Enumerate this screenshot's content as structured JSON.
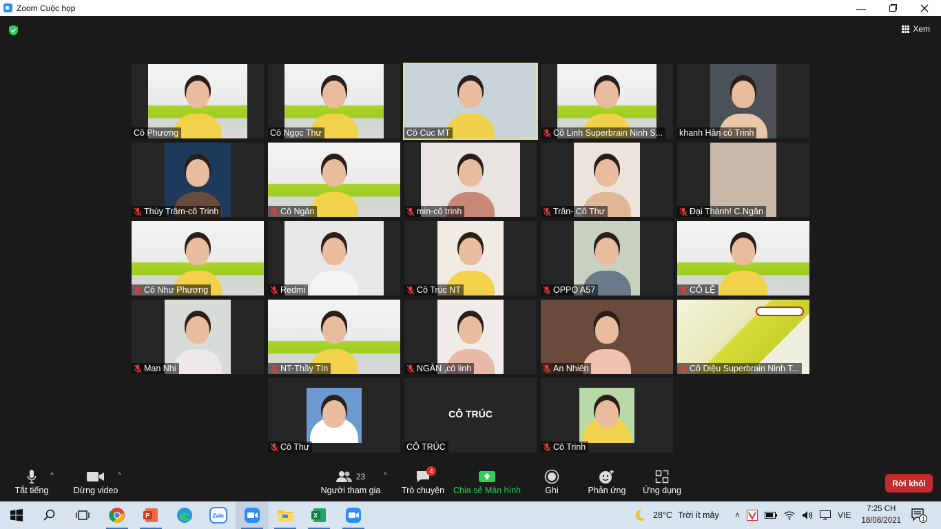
{
  "window": {
    "title": "Zoom Cuộc họp"
  },
  "top_bar": {
    "view_label": "Xem"
  },
  "participants": [
    {
      "name": "Cô Phương",
      "muted": false,
      "scene": "class",
      "bg": "#e6e0c8",
      "person": "#f2d24a"
    },
    {
      "name": "Cô Ngọc Thư",
      "muted": false,
      "scene": "class",
      "bg": "#e6e0c8",
      "person": "#f2d24a"
    },
    {
      "name": "Cô Cúc MT",
      "muted": false,
      "scene": "room",
      "bg": "#c8d4da",
      "person": "#f0d04a",
      "active": true
    },
    {
      "name": "Cô Linh Superbrain Ninh S...",
      "muted": true,
      "scene": "class",
      "bg": "#e6e0c8",
      "person": "#f2d24a"
    },
    {
      "name": "khanh Hân cô Trinh",
      "muted": false,
      "scene": "home",
      "bg": "#4a5258",
      "person": "#e8c8a8"
    },
    {
      "name": "Thùy Trâm-cô Trinh",
      "muted": true,
      "scene": "dark",
      "bg": "#1d3a5a",
      "person": "#6a4a3a"
    },
    {
      "name": "Cô Ngân",
      "muted": true,
      "scene": "class",
      "bg": "#e6e0c8",
      "person": "#f2d24a"
    },
    {
      "name": "min-cô trinh",
      "muted": true,
      "scene": "home",
      "bg": "#e8e4e0",
      "person": "#c88878"
    },
    {
      "name": "Trân- Cô Thư",
      "muted": true,
      "scene": "home",
      "bg": "#ece4dc",
      "person": "#e0b898"
    },
    {
      "name": "Đại Thành! C.Ngân",
      "muted": true,
      "scene": "blur",
      "bg": "#c8b8a8",
      "person": "#b09888"
    },
    {
      "name": "Cô Như Phương",
      "muted": true,
      "scene": "class",
      "bg": "#e6e0c8",
      "person": "#f2d24a"
    },
    {
      "name": "Redmi",
      "muted": true,
      "scene": "home",
      "bg": "#e8e8e8",
      "person": "#f4f4f4"
    },
    {
      "name": "Cô Trúc NT",
      "muted": true,
      "scene": "home",
      "bg": "#f0ece4",
      "person": "#f2d24a"
    },
    {
      "name": "OPPO A57",
      "muted": true,
      "scene": "home",
      "bg": "#c8d0c0",
      "person": "#6a7a8a"
    },
    {
      "name": "CÔ LỆ",
      "muted": true,
      "scene": "class",
      "bg": "#e6e0c8",
      "person": "#f2d24a"
    },
    {
      "name": "Man Nhi",
      "muted": true,
      "scene": "home",
      "bg": "#d8dcd8",
      "person": "#ece8ec"
    },
    {
      "name": "NT-Thầy Tín",
      "muted": true,
      "scene": "class",
      "bg": "#e6e0c8",
      "person": "#f2d24a"
    },
    {
      "name": "NGÂN ,cô linh",
      "muted": true,
      "scene": "home",
      "bg": "#f0ece8",
      "person": "#e8b8a8"
    },
    {
      "name": "An Nhiên",
      "muted": true,
      "scene": "home",
      "bg": "#6a4a3a",
      "person": "#f0c0b0"
    },
    {
      "name": "Cô Diệu Superbrain Ninh T...",
      "muted": true,
      "scene": "brand",
      "bg": "#e8e8c0",
      "person": "#d8d23a"
    },
    {
      "name": "Cô Thư",
      "muted": true,
      "scene": "photo",
      "bg": "#6a9ad0",
      "person": "#ffffff"
    },
    {
      "name": "CÔ TRÚC",
      "muted": false,
      "scene": "noimg",
      "bg": "#262626",
      "person": "#262626",
      "display": "CÔ TRÚC"
    },
    {
      "name": "Cô Trinh",
      "muted": true,
      "scene": "photo2",
      "bg": "#b8d8a8",
      "person": "#f2d24a"
    }
  ],
  "toolbar": {
    "mute": "Tắt tiếng",
    "video": "Dừng video",
    "participants": "Người tham gia",
    "participants_count": "23",
    "chat": "Trò chuyện",
    "chat_badge": "4",
    "share": "Chia sẻ Màn hình",
    "record": "Ghi",
    "reactions": "Phản ứng",
    "apps": "Ứng dụng",
    "leave": "Rời khỏi"
  },
  "taskbar": {
    "weather_temp": "28°C",
    "weather_text": "Trời ít mây",
    "language": "VIE",
    "time": "7:25 CH",
    "date": "18/08/2021",
    "notifications": "1",
    "apps": [
      "start-icon",
      "search-icon",
      "task-view-icon",
      "chrome-icon",
      "powerpoint-icon",
      "edge-icon",
      "zalo-icon",
      "zoom-icon",
      "file-explorer-icon",
      "excel-icon",
      "zoom-icon"
    ],
    "zalo_label": "Zalo",
    "accent": "#2d8cff"
  }
}
